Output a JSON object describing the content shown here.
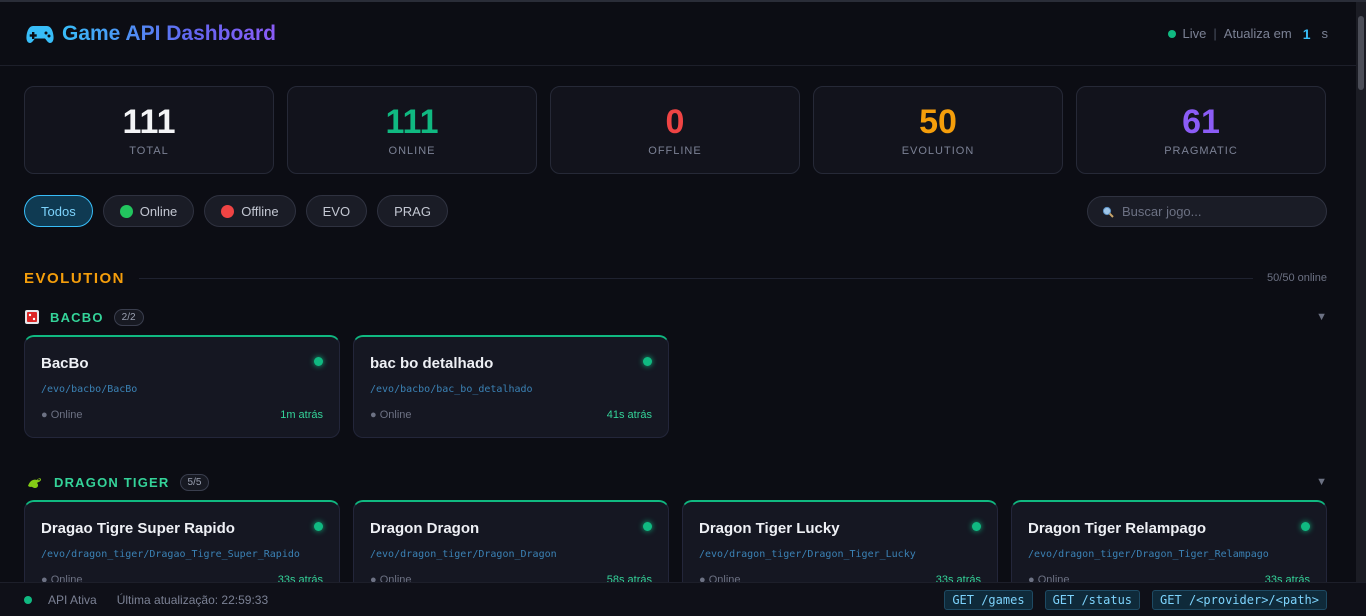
{
  "header": {
    "title": "Game API Dashboard",
    "icon": "gamepad-icon",
    "live_label": "Live",
    "separator": "|",
    "refresh_prefix": "Atualiza em",
    "refresh_value": "1",
    "refresh_unit": "s"
  },
  "stats": [
    {
      "value": "111",
      "label": "TOTAL",
      "color": "#f3f4f6"
    },
    {
      "value": "111",
      "label": "ONLINE",
      "color": "#10b981"
    },
    {
      "value": "0",
      "label": "OFFLINE",
      "color": "#ef4444"
    },
    {
      "value": "50",
      "label": "EVOLUTION",
      "color": "#f59e0b"
    },
    {
      "value": "61",
      "label": "PRAGMATIC",
      "color": "#8b5cf6"
    }
  ],
  "filters": {
    "all": "Todos",
    "online": "Online",
    "offline": "Offline",
    "evo": "EVO",
    "prag": "PRAG",
    "online_color": "#22c55e",
    "offline_color": "#ef4444"
  },
  "search": {
    "placeholder": "Buscar jogo...",
    "icon": "search-icon"
  },
  "section": {
    "title": "EVOLUTION",
    "count": "50/50 online"
  },
  "groups": {
    "bacbo": {
      "title": "BACBO",
      "badge": "2/2",
      "icon": "dice-icon",
      "cards": [
        {
          "name": "BacBo",
          "path": "/evo/bacbo/BacBo",
          "state": "● Online",
          "ago": "1m atrás"
        },
        {
          "name": "bac bo detalhado",
          "path": "/evo/bacbo/bac_bo_detalhado",
          "state": "● Online",
          "ago": "41s atrás"
        }
      ]
    },
    "dragon": {
      "title": "DRAGON TIGER",
      "badge": "5/5",
      "icon": "dragon-icon",
      "cards": [
        {
          "name": "Dragao Tigre Super Rapido",
          "path": "/evo/dragon_tiger/Dragao_Tigre_Super_Rapido",
          "state": "● Online",
          "ago": "33s atrás"
        },
        {
          "name": "Dragon Dragon",
          "path": "/evo/dragon_tiger/Dragon_Dragon",
          "state": "● Online",
          "ago": "58s atrás"
        },
        {
          "name": "Dragon Tiger Lucky",
          "path": "/evo/dragon_tiger/Dragon_Tiger_Lucky",
          "state": "● Online",
          "ago": "33s atrás"
        },
        {
          "name": "Dragon Tiger Relampago",
          "path": "/evo/dragon_tiger/Dragon_Tiger_Relampago",
          "state": "● Online",
          "ago": "33s atrás"
        }
      ]
    }
  },
  "footer": {
    "status": "API Ativa",
    "updated": "Última atualização: 22:59:33",
    "endpoints": [
      "GET /games",
      "GET /status",
      "GET /<provider>/<path>"
    ]
  }
}
